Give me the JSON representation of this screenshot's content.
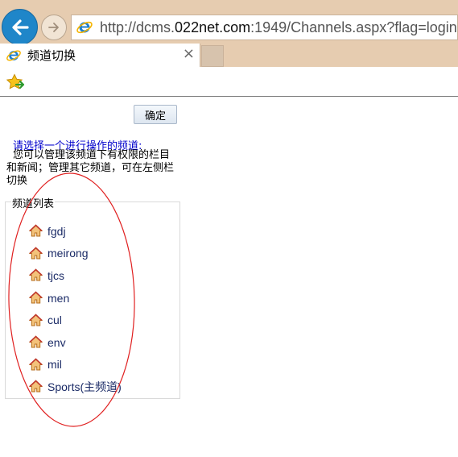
{
  "browser": {
    "url_prefix": "http://dcms.",
    "url_domain": "022net.com",
    "url_suffix": ":1949/Channels.aspx?flag=login",
    "tab_title": "频道切换",
    "tab_close": "×"
  },
  "page": {
    "confirm_label": "确定",
    "prompt": "请选择一个进行操作的频道:",
    "description": "您可以管理该频道下有权限的栏目和新闻；管理其它频道，可在左侧栏切换",
    "legend": "频道列表",
    "channels": [
      "fgdj",
      "meirong",
      "tjcs",
      "men",
      "cul",
      "env",
      "mil",
      "Sports(主频道)"
    ]
  },
  "colors": {
    "chrome": "#e6ccb0",
    "back_button": "#1f86c9",
    "prompt_text": "#0000cc",
    "annotation_ellipse": "#e02020"
  }
}
